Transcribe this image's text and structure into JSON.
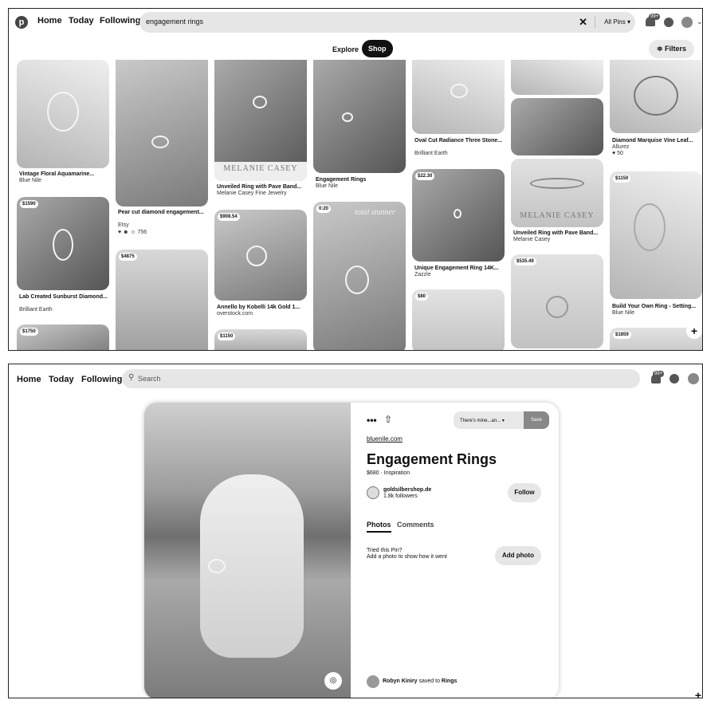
{
  "panel1": {
    "header": {
      "logo": "p",
      "nav": [
        "Home",
        "Today",
        "Following"
      ],
      "search_value": "engagement rings",
      "clear_icon": "close-icon",
      "scope": "All Pins ▾",
      "notif_badge": "99+"
    },
    "tabs": [
      "Explore",
      "Shop"
    ],
    "filters_label": "Filters",
    "pins": [
      {
        "title": "Vintage Floral Aquamarine...",
        "source": "Blue Nile"
      },
      {
        "price": "$1590",
        "title": "Lab Created Sunburst Diamond...",
        "source": "Brilliant Earth"
      },
      {
        "price": "$1750"
      },
      {
        "title": "Pear cut diamond engagement...",
        "source": "Etsy",
        "extra": "♥ ☻ ☺ 756"
      },
      {
        "price": "$4875"
      },
      {
        "title": "Unveiled Ring with Pave Band...",
        "source": "Melanie Casey Fine Jewelry",
        "watermark": "MELANIE CASEY"
      },
      {
        "price": "$908.54",
        "title": "Annello by Kobelli 14k Gold 1...",
        "source": "overstock.com"
      },
      {
        "price": "$1150"
      },
      {
        "title": "Engagement Rings",
        "source": "Blue Nile"
      },
      {
        "price": "0:20",
        "script_text": "total stunner"
      },
      {
        "title": "Oval Cut Radiance Three Stone...",
        "source": "Brilliant Earth"
      },
      {
        "price": "$22.30",
        "title": "Unique Engagement Ring 14K...",
        "source": "Zazzle"
      },
      {
        "price": "$80"
      },
      {
        "title": "Unveiled Ring with Pave Band...",
        "source": "Melanie Casey",
        "watermark": "MELANIE CASEY"
      },
      {
        "price": "$535.49"
      },
      {
        "title": "Diamond Marquise Vine Leaf...",
        "source": "Allurez",
        "extra": "♥ 50"
      },
      {
        "price": "$1150",
        "title": "Build Your Own Ring - Setting...",
        "source": "Blue Nile"
      },
      {
        "price": "$1859"
      }
    ],
    "plus": "+"
  },
  "panel2": {
    "header": {
      "nav": [
        "Home",
        "Today",
        "Following"
      ],
      "search_placeholder": "Search",
      "notif_badge": "99+"
    },
    "pin": {
      "more": "•••",
      "board_select": "There's mine...an... ▾",
      "save_label": "Save",
      "domain": "bluenile.com",
      "title": "Engagement Rings",
      "meta": "$680 · Inspiration",
      "user_name": "goldsilbershop.de",
      "user_followers": "1.8k followers",
      "follow_label": "Follow",
      "tab_photos": "Photos",
      "tab_comments": "Comments",
      "tried_line1": "Tried this Pin?",
      "tried_line2": "Add a photo to show how it went",
      "add_photo_label": "Add photo",
      "saver": "Robyn Kiniry",
      "saved_to": " saved to ",
      "saved_board": "Rings"
    },
    "plus": "+"
  }
}
